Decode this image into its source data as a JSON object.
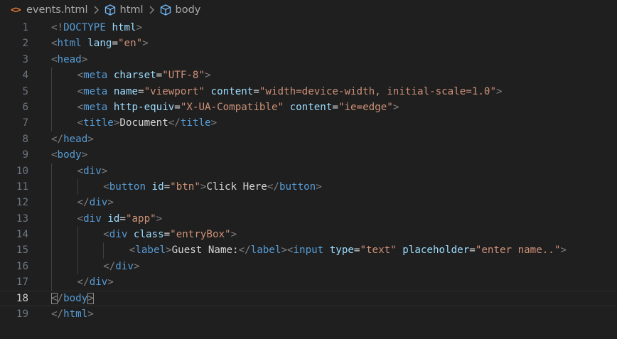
{
  "breadcrumb": {
    "file": "events.html",
    "file_icon": "html-file-icon",
    "items": [
      "html",
      "body"
    ]
  },
  "editor": {
    "current_line": 18,
    "lines": [
      {
        "num": "1",
        "indent": 0,
        "tokens": [
          [
            "punc",
            "<!"
          ],
          [
            "tag",
            "DOCTYPE"
          ],
          [
            "text",
            " "
          ],
          [
            "attr",
            "html"
          ],
          [
            "punc",
            ">"
          ]
        ]
      },
      {
        "num": "2",
        "indent": 0,
        "tokens": [
          [
            "punc",
            "<"
          ],
          [
            "tag",
            "html"
          ],
          [
            "text",
            " "
          ],
          [
            "attr",
            "lang"
          ],
          [
            "eq",
            "="
          ],
          [
            "str",
            "\"en\""
          ],
          [
            "punc",
            ">"
          ]
        ]
      },
      {
        "num": "3",
        "indent": 0,
        "tokens": [
          [
            "punc",
            "<"
          ],
          [
            "tag",
            "head"
          ],
          [
            "punc",
            ">"
          ]
        ]
      },
      {
        "num": "4",
        "indent": 1,
        "tokens": [
          [
            "punc",
            "<"
          ],
          [
            "tag",
            "meta"
          ],
          [
            "text",
            " "
          ],
          [
            "attr",
            "charset"
          ],
          [
            "eq",
            "="
          ],
          [
            "str",
            "\"UTF-8\""
          ],
          [
            "punc",
            ">"
          ]
        ]
      },
      {
        "num": "5",
        "indent": 1,
        "tokens": [
          [
            "punc",
            "<"
          ],
          [
            "tag",
            "meta"
          ],
          [
            "text",
            " "
          ],
          [
            "attr",
            "name"
          ],
          [
            "eq",
            "="
          ],
          [
            "str",
            "\"viewport\""
          ],
          [
            "text",
            " "
          ],
          [
            "attr",
            "content"
          ],
          [
            "eq",
            "="
          ],
          [
            "str",
            "\"width=device-width, initial-scale=1.0\""
          ],
          [
            "punc",
            ">"
          ]
        ]
      },
      {
        "num": "6",
        "indent": 1,
        "tokens": [
          [
            "punc",
            "<"
          ],
          [
            "tag",
            "meta"
          ],
          [
            "text",
            " "
          ],
          [
            "attr",
            "http-equiv"
          ],
          [
            "eq",
            "="
          ],
          [
            "str",
            "\"X-UA-Compatible\""
          ],
          [
            "text",
            " "
          ],
          [
            "attr",
            "content"
          ],
          [
            "eq",
            "="
          ],
          [
            "str",
            "\"ie=edge\""
          ],
          [
            "punc",
            ">"
          ]
        ]
      },
      {
        "num": "7",
        "indent": 1,
        "tokens": [
          [
            "punc",
            "<"
          ],
          [
            "tag",
            "title"
          ],
          [
            "punc",
            ">"
          ],
          [
            "text",
            "Document"
          ],
          [
            "punc",
            "</"
          ],
          [
            "tag",
            "title"
          ],
          [
            "punc",
            ">"
          ]
        ]
      },
      {
        "num": "8",
        "indent": 0,
        "tokens": [
          [
            "punc",
            "</"
          ],
          [
            "tag",
            "head"
          ],
          [
            "punc",
            ">"
          ]
        ]
      },
      {
        "num": "9",
        "indent": 0,
        "tokens": [
          [
            "punc",
            "<"
          ],
          [
            "tag",
            "body"
          ],
          [
            "punc",
            ">"
          ]
        ]
      },
      {
        "num": "10",
        "indent": 1,
        "tokens": [
          [
            "punc",
            "<"
          ],
          [
            "tag",
            "div"
          ],
          [
            "punc",
            ">"
          ]
        ]
      },
      {
        "num": "11",
        "indent": 2,
        "tokens": [
          [
            "punc",
            "<"
          ],
          [
            "tag",
            "button"
          ],
          [
            "text",
            " "
          ],
          [
            "attr",
            "id"
          ],
          [
            "eq",
            "="
          ],
          [
            "str",
            "\"btn\""
          ],
          [
            "punc",
            ">"
          ],
          [
            "text",
            "Click Here"
          ],
          [
            "punc",
            "</"
          ],
          [
            "tag",
            "button"
          ],
          [
            "punc",
            ">"
          ]
        ]
      },
      {
        "num": "12",
        "indent": 1,
        "tokens": [
          [
            "punc",
            "</"
          ],
          [
            "tag",
            "div"
          ],
          [
            "punc",
            ">"
          ]
        ]
      },
      {
        "num": "13",
        "indent": 1,
        "tokens": [
          [
            "punc",
            "<"
          ],
          [
            "tag",
            "div"
          ],
          [
            "text",
            " "
          ],
          [
            "attr",
            "id"
          ],
          [
            "eq",
            "="
          ],
          [
            "str",
            "\"app\""
          ],
          [
            "punc",
            ">"
          ]
        ]
      },
      {
        "num": "14",
        "indent": 2,
        "tokens": [
          [
            "punc",
            "<"
          ],
          [
            "tag",
            "div"
          ],
          [
            "text",
            " "
          ],
          [
            "attr",
            "class"
          ],
          [
            "eq",
            "="
          ],
          [
            "str",
            "\"entryBox\""
          ],
          [
            "punc",
            ">"
          ]
        ]
      },
      {
        "num": "15",
        "indent": 3,
        "tokens": [
          [
            "punc",
            "<"
          ],
          [
            "tag",
            "label"
          ],
          [
            "punc",
            ">"
          ],
          [
            "text",
            "Guest Name:"
          ],
          [
            "punc",
            "</"
          ],
          [
            "tag",
            "label"
          ],
          [
            "punc",
            "><"
          ],
          [
            "tag",
            "input"
          ],
          [
            "text",
            " "
          ],
          [
            "attr",
            "type"
          ],
          [
            "eq",
            "="
          ],
          [
            "str",
            "\"text\""
          ],
          [
            "text",
            " "
          ],
          [
            "attr",
            "placeholder"
          ],
          [
            "eq",
            "="
          ],
          [
            "str",
            "\"enter name..\""
          ],
          [
            "punc",
            ">"
          ]
        ]
      },
      {
        "num": "16",
        "indent": 2,
        "tokens": [
          [
            "punc",
            "</"
          ],
          [
            "tag",
            "div"
          ],
          [
            "punc",
            ">"
          ]
        ]
      },
      {
        "num": "17",
        "indent": 1,
        "tokens": [
          [
            "punc",
            "</"
          ],
          [
            "tag",
            "div"
          ],
          [
            "punc",
            ">"
          ]
        ]
      },
      {
        "num": "18",
        "indent": 0,
        "tokens": [
          [
            "punc",
            "</"
          ],
          [
            "tag",
            "body"
          ],
          [
            "punc",
            ">"
          ]
        ]
      },
      {
        "num": "19",
        "indent": 0,
        "tokens": [
          [
            "punc",
            "</"
          ],
          [
            "tag",
            "html"
          ],
          [
            "punc",
            ">"
          ]
        ]
      }
    ]
  },
  "colors": {
    "background": "#1f1f1f",
    "tag": "#569cd6",
    "attribute": "#9cdcfe",
    "string": "#ce9178",
    "punctuation": "#808080",
    "text": "#d4d4d4",
    "line_number": "#6e7681",
    "file_icon": "#e37933"
  }
}
